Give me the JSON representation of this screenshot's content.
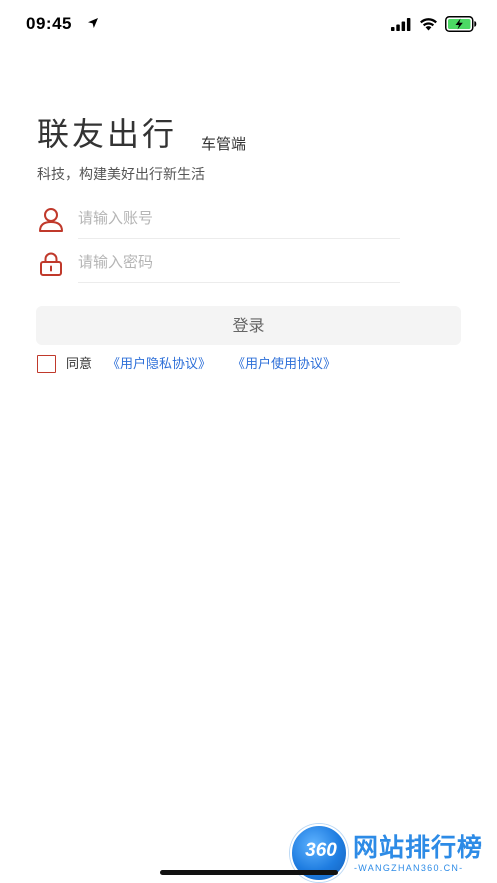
{
  "status_bar": {
    "time": "09:45",
    "icons": [
      "location-arrow-icon",
      "cellular-signal-icon",
      "wifi-icon",
      "battery-charging-icon"
    ]
  },
  "header": {
    "title": "联友出行",
    "subtitle": "车管端",
    "slogan": "科技，构建美好出行新生活"
  },
  "form": {
    "username": {
      "value": "",
      "placeholder": "请输入账号",
      "icon": "user-icon"
    },
    "password": {
      "value": "",
      "placeholder": "请输入密码",
      "icon": "lock-icon"
    },
    "login_label": "登录"
  },
  "agreement": {
    "checked": false,
    "label": "同意",
    "privacy_link": "《用户隐私协议》",
    "terms_link": "《用户使用协议》"
  },
  "colors": {
    "accent_red": "#c0392b",
    "link_blue": "#2d6fd8",
    "button_bg": "#f4f4f4"
  },
  "watermark": {
    "badge": "360",
    "title": "网站排行榜",
    "subtitle": "-WANGZHAN360.CN-"
  }
}
